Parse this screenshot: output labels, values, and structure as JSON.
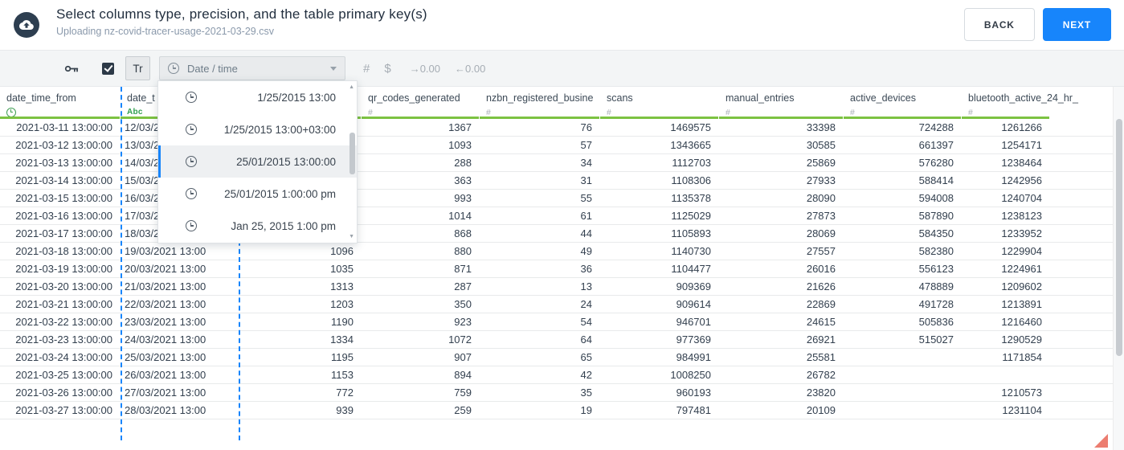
{
  "header": {
    "title": "Select columns type, precision, and the table primary key(s)",
    "subtitle": "Uploading nz-covid-tracer-usage-2021-03-29.csv",
    "back_label": "BACK",
    "next_label": "NEXT"
  },
  "toolbar": {
    "text_type_label": "Tr",
    "type_select_value": "Date / time",
    "integer_label": "#",
    "currency_label": "$",
    "inc_decimals_label": "→0.00",
    "dec_decimals_label": "←0.00"
  },
  "format_dropdown": {
    "options": [
      "1/25/2015 13:00",
      "1/25/2015 13:00+03:00",
      "25/01/2015 13:00:00",
      "25/01/2015 1:00:00 pm",
      "Jan 25, 2015 1:00 pm"
    ],
    "selected_index": 2
  },
  "table": {
    "selected_column_index": 1,
    "columns": [
      {
        "name": "date_time_from",
        "type_icon": "clock-icon",
        "type_label": ""
      },
      {
        "name": "date_t",
        "type_icon": "",
        "type_label": "Abc"
      },
      {
        "name": "",
        "type_icon": "",
        "type_label": ""
      },
      {
        "name": "qr_codes_generated",
        "type_icon": "",
        "type_label": "#"
      },
      {
        "name": "nzbn_registered_busine",
        "type_icon": "",
        "type_label": "#"
      },
      {
        "name": "scans",
        "type_icon": "",
        "type_label": "#"
      },
      {
        "name": "manual_entries",
        "type_icon": "",
        "type_label": "#"
      },
      {
        "name": "active_devices",
        "type_icon": "",
        "type_label": "#"
      },
      {
        "name": "bluetooth_active_24_hr_",
        "type_icon": "",
        "type_label": "#"
      }
    ],
    "rows": [
      [
        "2021-03-11 13:00:00",
        "12/03/2021 13:00",
        "",
        "1367",
        "76",
        "1469575",
        "33398",
        "724288",
        "1261266"
      ],
      [
        "2021-03-12 13:00:00",
        "13/03/2021 13:00",
        "",
        "1093",
        "57",
        "1343665",
        "30585",
        "661397",
        "1254171"
      ],
      [
        "2021-03-13 13:00:00",
        "14/03/2021 13:00",
        "",
        "288",
        "34",
        "1112703",
        "25869",
        "576280",
        "1238464"
      ],
      [
        "2021-03-14 13:00:00",
        "15/03/2021 13:00",
        "",
        "363",
        "31",
        "1108306",
        "27933",
        "588414",
        "1242956"
      ],
      [
        "2021-03-15 13:00:00",
        "16/03/2021 13:00",
        "",
        "993",
        "55",
        "1135378",
        "28090",
        "594008",
        "1240704"
      ],
      [
        "2021-03-16 13:00:00",
        "17/03/2021 13:00",
        "",
        "1014",
        "61",
        "1125029",
        "27873",
        "587890",
        "1238123"
      ],
      [
        "2021-03-17 13:00:00",
        "18/03/2021 13:00",
        "",
        "868",
        "44",
        "1105893",
        "28069",
        "584350",
        "1233952"
      ],
      [
        "2021-03-18 13:00:00",
        "19/03/2021 13:00",
        "1096",
        "880",
        "49",
        "1140730",
        "27557",
        "582380",
        "1229904"
      ],
      [
        "2021-03-19 13:00:00",
        "20/03/2021 13:00",
        "1035",
        "871",
        "36",
        "1104477",
        "26016",
        "556123",
        "1224961"
      ],
      [
        "2021-03-20 13:00:00",
        "21/03/2021 13:00",
        "1313",
        "287",
        "13",
        "909369",
        "21626",
        "478889",
        "1209602"
      ],
      [
        "2021-03-21 13:00:00",
        "22/03/2021 13:00",
        "1203",
        "350",
        "24",
        "909614",
        "22869",
        "491728",
        "1213891"
      ],
      [
        "2021-03-22 13:00:00",
        "23/03/2021 13:00",
        "1190",
        "923",
        "54",
        "946701",
        "24615",
        "505836",
        "1216460"
      ],
      [
        "2021-03-23 13:00:00",
        "24/03/2021 13:00",
        "1334",
        "1072",
        "64",
        "977369",
        "26921",
        "515027",
        "1290529"
      ],
      [
        "2021-03-24 13:00:00",
        "25/03/2021 13:00",
        "1195",
        "907",
        "65",
        "984991",
        "25581",
        "",
        "1171854"
      ],
      [
        "2021-03-25 13:00:00",
        "26/03/2021 13:00",
        "1153",
        "894",
        "42",
        "1008250",
        "26782",
        "",
        ""
      ],
      [
        "2021-03-26 13:00:00",
        "27/03/2021 13:00",
        "772",
        "759",
        "35",
        "960193",
        "23820",
        "",
        "1210573"
      ],
      [
        "2021-03-27 13:00:00",
        "28/03/2021 13:00",
        "939",
        "259",
        "19",
        "797481",
        "20109",
        "",
        "1231104"
      ]
    ]
  },
  "colors": {
    "accent_blue": "#1785fb",
    "quality_green": "#7cc242",
    "type_text_green": "#2f9e4f"
  }
}
